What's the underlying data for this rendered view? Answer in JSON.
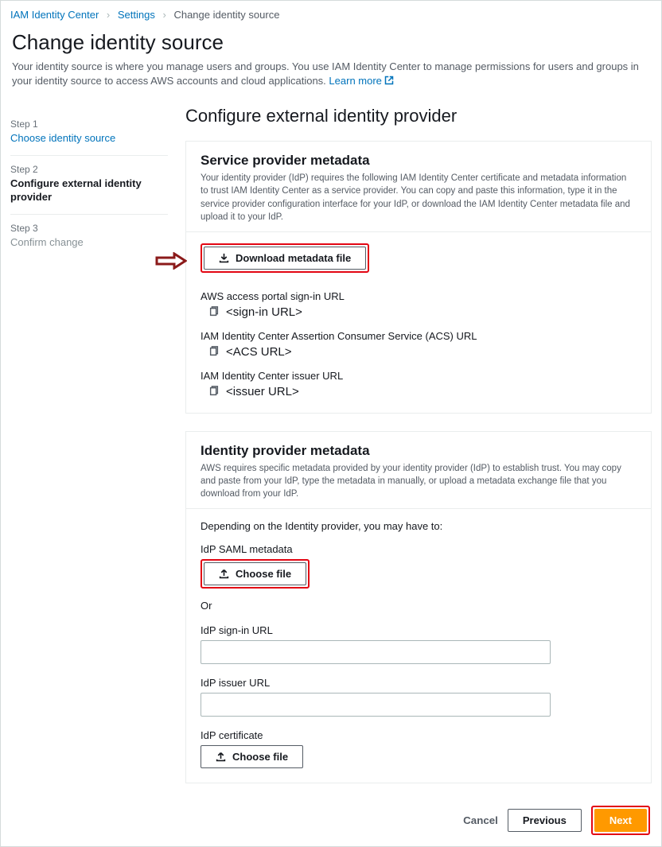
{
  "breadcrumb": {
    "item1": "IAM Identity Center",
    "item2": "Settings",
    "current": "Change identity source"
  },
  "header": {
    "title": "Change identity source",
    "desc": "Your identity source is where you manage users and groups. You use IAM Identity Center to manage permissions for users and groups in your identity source to access AWS accounts and cloud applications.",
    "learn_more": "Learn more"
  },
  "steps": {
    "s1_label": "Step 1",
    "s1_text": "Choose identity source",
    "s2_label": "Step 2",
    "s2_text": "Configure external identity provider",
    "s3_label": "Step 3",
    "s3_text": "Confirm change"
  },
  "main_title": "Configure external identity provider",
  "sp": {
    "title": "Service provider metadata",
    "desc": "Your identity provider (IdP) requires the following IAM Identity Center certificate and metadata information to trust IAM Identity Center as a service provider. You can copy and paste this information, type it in the service provider configuration interface for your IdP, or download the IAM Identity Center metadata file and upload it to your IdP.",
    "download_btn": "Download metadata file",
    "f1_label": "AWS access portal sign-in URL",
    "f1_value": "<sign-in URL>",
    "f2_label": "IAM Identity Center Assertion Consumer Service (ACS) URL",
    "f2_value": "<ACS URL>",
    "f3_label": "IAM Identity Center issuer URL",
    "f3_value": "<issuer URL>"
  },
  "idp": {
    "title": "Identity provider metadata",
    "desc": "AWS requires specific metadata provided by your identity provider (IdP) to establish trust. You may copy and paste from your IdP, type the metadata in manually, or upload a metadata exchange file that you download from your IdP.",
    "subtext": "Depending on the Identity provider, you may have to:",
    "saml_label": "IdP SAML metadata",
    "choose_file": "Choose file",
    "or": "Or",
    "signin_label": "IdP sign-in URL",
    "issuer_label": "IdP issuer URL",
    "cert_label": "IdP certificate",
    "choose_file2": "Choose file"
  },
  "actions": {
    "cancel": "Cancel",
    "previous": "Previous",
    "next": "Next"
  }
}
